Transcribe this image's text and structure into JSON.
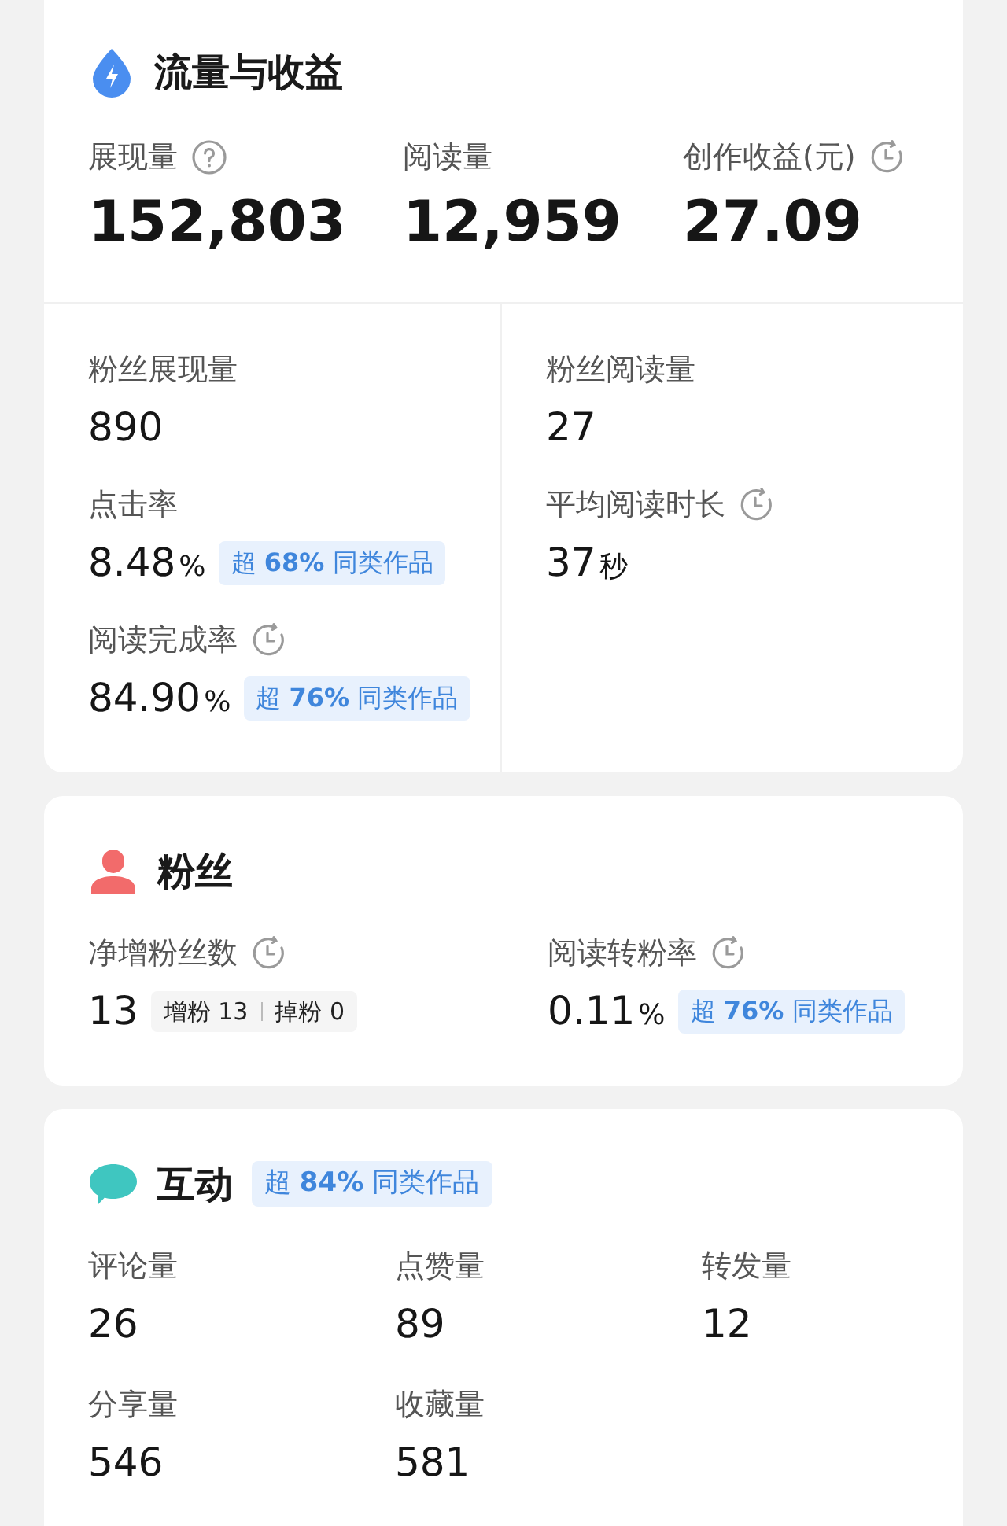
{
  "traffic": {
    "title": "流量与收益",
    "headline": [
      {
        "kind": "help",
        "label": "展现量",
        "value": "152,803"
      },
      {
        "label": "阅读量",
        "value": "12,959"
      },
      {
        "kind": "history",
        "label": "创作收益(元)",
        "value": "27.09"
      }
    ],
    "left": [
      {
        "label": "粉丝展现量",
        "value": "890"
      },
      {
        "label": "点击率",
        "value": "8.48",
        "unit": "%",
        "badge": "超 **68%** 同类作品"
      },
      {
        "kind": "history",
        "label": "阅读完成率",
        "value": "84.90",
        "unit": "%",
        "badge": "超 **76%** 同类作品"
      }
    ],
    "right": [
      {
        "label": "粉丝阅读量",
        "value": "27"
      },
      {
        "kind": "history",
        "label": "平均阅读时长",
        "value": "37",
        "unit": "秒"
      }
    ]
  },
  "fans": {
    "title": "粉丝",
    "metrics": [
      {
        "kind": "history",
        "label": "净增粉丝数",
        "value": "13",
        "breakdown": [
          {
            "label": "增粉",
            "value": "13"
          },
          {
            "label": "掉粉",
            "value": "0"
          }
        ]
      },
      {
        "kind": "history",
        "label": "阅读转粉率",
        "value": "0.11",
        "unit": "%",
        "badge": "超 **76%** 同类作品"
      }
    ]
  },
  "interaction": {
    "title": "互动",
    "badge": "超 **84%** 同类作品",
    "metrics": [
      {
        "label": "评论量",
        "value": "26"
      },
      {
        "label": "点赞量",
        "value": "89"
      },
      {
        "label": "转发量",
        "value": "12"
      },
      {
        "label": "分享量",
        "value": "546"
      },
      {
        "label": "收藏量",
        "value": "581"
      }
    ]
  }
}
